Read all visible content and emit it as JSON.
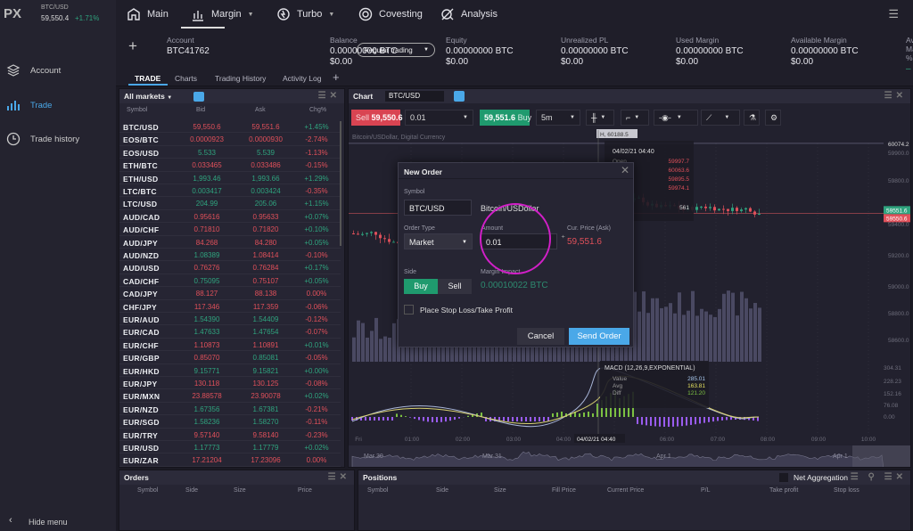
{
  "brand": {
    "logo": "PX",
    "ticker_symbol": "BTC/USD",
    "ticker_price": "59,550.4",
    "ticker_change": "+1.71%"
  },
  "sidebar": {
    "items": [
      {
        "label": "Account",
        "icon": "layers-icon"
      },
      {
        "label": "Trade",
        "icon": "bar-chart-icon",
        "active": true
      },
      {
        "label": "Trade history",
        "icon": "clock-icon"
      }
    ],
    "hide_menu": "Hide menu"
  },
  "nav": {
    "items": [
      {
        "label": "Main"
      },
      {
        "label": "Margin",
        "active": true
      },
      {
        "label": "Turbo"
      },
      {
        "label": "Covesting"
      },
      {
        "label": "Analysis"
      }
    ]
  },
  "account": {
    "label": "Account",
    "id": "BTC41762",
    "mode": "Regular trading",
    "metrics": [
      {
        "label": "Balance",
        "btc": "0.00000000 BTC",
        "usd": "$0.00"
      },
      {
        "label": "Equity",
        "btc": "0.00000000 BTC",
        "usd": "$0.00"
      },
      {
        "label": "Unrealized PL",
        "btc": "0.00000000 BTC",
        "usd": "$0.00"
      },
      {
        "label": "Used Margin",
        "btc": "0.00000000 BTC",
        "usd": "$0.00"
      },
      {
        "label": "Available Margin",
        "btc": "0.00000000 BTC",
        "usd": "$0.00"
      },
      {
        "label": "Available Margin, %",
        "btc": "–",
        "usd": ""
      }
    ]
  },
  "tabs": [
    "TRADE",
    "Charts",
    "Trading History",
    "Activity Log"
  ],
  "markets": {
    "title": "All markets",
    "columns": [
      "Symbol",
      "Bid",
      "Ask",
      "Chg%"
    ],
    "rows": [
      [
        "BTC/USD",
        "59,550.6",
        "59,551.6",
        "+1.45%",
        "down",
        "down",
        "up"
      ],
      [
        "EOS/BTC",
        "0.0000923",
        "0.0000930",
        "-2.74%",
        "down",
        "down",
        "down"
      ],
      [
        "EOS/USD",
        "5.533",
        "5.539",
        "-1.13%",
        "up",
        "up",
        "down"
      ],
      [
        "ETH/BTC",
        "0.033465",
        "0.033486",
        "-0.15%",
        "down",
        "down",
        "down"
      ],
      [
        "ETH/USD",
        "1,993.46",
        "1,993.66",
        "+1.29%",
        "up",
        "up",
        "up"
      ],
      [
        "LTC/BTC",
        "0.003417",
        "0.003424",
        "-0.35%",
        "up",
        "up",
        "down"
      ],
      [
        "LTC/USD",
        "204.99",
        "205.06",
        "+1.15%",
        "up",
        "up",
        "up"
      ],
      [
        "AUD/CAD",
        "0.95616",
        "0.95633",
        "+0.07%",
        "down",
        "down",
        "up"
      ],
      [
        "AUD/CHF",
        "0.71810",
        "0.71820",
        "+0.10%",
        "down",
        "down",
        "up"
      ],
      [
        "AUD/JPY",
        "84.268",
        "84.280",
        "+0.05%",
        "down",
        "down",
        "up"
      ],
      [
        "AUD/NZD",
        "1.08389",
        "1.08414",
        "-0.10%",
        "up",
        "down",
        "down"
      ],
      [
        "AUD/USD",
        "0.76276",
        "0.76284",
        "+0.17%",
        "down",
        "down",
        "up"
      ],
      [
        "CAD/CHF",
        "0.75095",
        "0.75107",
        "+0.05%",
        "up",
        "down",
        "up"
      ],
      [
        "CAD/JPY",
        "88.127",
        "88.138",
        "0.00%",
        "down",
        "down",
        "down"
      ],
      [
        "CHF/JPY",
        "117.346",
        "117.359",
        "-0.06%",
        "down",
        "down",
        "down"
      ],
      [
        "EUR/AUD",
        "1.54390",
        "1.54409",
        "-0.12%",
        "up",
        "up",
        "down"
      ],
      [
        "EUR/CAD",
        "1.47633",
        "1.47654",
        "-0.07%",
        "up",
        "up",
        "down"
      ],
      [
        "EUR/CHF",
        "1.10873",
        "1.10891",
        "+0.01%",
        "down",
        "down",
        "up"
      ],
      [
        "EUR/GBP",
        "0.85070",
        "0.85081",
        "-0.05%",
        "down",
        "up",
        "down"
      ],
      [
        "EUR/HKD",
        "9.15771",
        "9.15821",
        "+0.00%",
        "up",
        "up",
        "up"
      ],
      [
        "EUR/JPY",
        "130.118",
        "130.125",
        "-0.08%",
        "down",
        "down",
        "down"
      ],
      [
        "EUR/MXN",
        "23.88578",
        "23.90078",
        "+0.02%",
        "down",
        "down",
        "up"
      ],
      [
        "EUR/NZD",
        "1.67356",
        "1.67381",
        "-0.21%",
        "up",
        "up",
        "down"
      ],
      [
        "EUR/SGD",
        "1.58236",
        "1.58270",
        "-0.11%",
        "up",
        "up",
        "down"
      ],
      [
        "EUR/TRY",
        "9.57140",
        "9.58140",
        "-0.23%",
        "down",
        "down",
        "down"
      ],
      [
        "EUR/USD",
        "1.17773",
        "1.17779",
        "+0.02%",
        "up",
        "up",
        "up"
      ],
      [
        "EUR/ZAR",
        "17.21204",
        "17.23096",
        "0.00%",
        "down",
        "down",
        "down"
      ]
    ]
  },
  "chart": {
    "title": "Chart",
    "symbol": "BTC/USD",
    "sell_label": "Sell",
    "sell_price": "59,550.6",
    "amount": "0.01",
    "buy_price": "59,551.6",
    "buy_label": "Buy",
    "interval": "5m",
    "description": "Bitcoin/USDollar, Digital Currency",
    "high_label": "H, 60188.5",
    "price_ticks": [
      "60074.2",
      "59900.0",
      "59800.0",
      "59400.0",
      "59200.0",
      "59000.0",
      "58800.0",
      "58600.0"
    ],
    "ask_tag": "59551.6",
    "bid_tag": "59550.6",
    "tooltip": {
      "date": "04/02/21 04:40",
      "open_label": "Open",
      "values": [
        "59997.7",
        "60063.6",
        "59895.5",
        "59974.1"
      ],
      "volume": "561"
    },
    "macd": {
      "title": "MACD (12,26,9,EXPONENTIAL)",
      "rows": [
        [
          "Value",
          "285.01"
        ],
        [
          "Avg",
          "163.81"
        ],
        [
          "Diff",
          "121.20"
        ]
      ],
      "ticks": [
        "304.31",
        "228.23",
        "152.16",
        "76.08",
        "0.00"
      ]
    },
    "time_ticks": [
      "Fri",
      "01:00",
      "02:00",
      "03:00",
      "04:00",
      "06:00",
      "07:00",
      "08:00",
      "09:00",
      "10:00"
    ],
    "cursor_time": "04/02/21 04:40",
    "nav_labels": [
      "Mar 30",
      "Mar 31",
      "Apr 1",
      "Apr 1"
    ],
    "colors": {
      "up": "#2fa37e",
      "down": "#e0505a",
      "accent": "#4aa8e8"
    }
  },
  "dialog": {
    "title": "New Order",
    "symbol_label": "Symbol",
    "symbol": "BTC/USD",
    "symbol_name": "Bitcoin/USDollar",
    "order_type_label": "Order Type",
    "order_type": "Market",
    "amount_label": "Amount",
    "amount": "0.01",
    "price_label": "Cur. Price (Ask)",
    "price": "59,551.6",
    "side_label": "Side",
    "buy": "Buy",
    "sell": "Sell",
    "margin_label": "Margin Impact",
    "margin": "0.00010022 BTC",
    "sltp": "Place Stop Loss/Take Profit",
    "cancel": "Cancel",
    "send": "Send Order"
  },
  "orders": {
    "title": "Orders",
    "columns": [
      "Symbol",
      "Side",
      "Size",
      "Price"
    ]
  },
  "positions": {
    "title": "Positions",
    "net_aggregation": "Net Aggregation",
    "columns": [
      "Symbol",
      "Side",
      "Size",
      "Fill Price",
      "Current Price",
      "P/L",
      "Take profit",
      "Stop loss"
    ]
  }
}
